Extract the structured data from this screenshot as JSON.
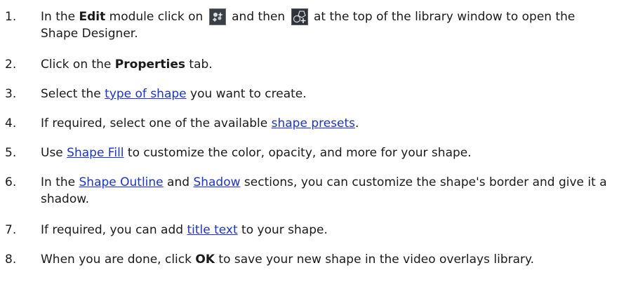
{
  "steps": [
    {
      "num": "1.",
      "parts": {
        "a": "In the ",
        "b": "Edit",
        "c": " module click on ",
        "icon1": "effects-toolbar-icon",
        "d": " and then ",
        "icon2": "add-shape-icon",
        "e": " at the top of the library window to open the Shape Designer."
      }
    },
    {
      "num": "2.",
      "parts": {
        "a": "Click on the ",
        "b": "Properties",
        "c": " tab."
      }
    },
    {
      "num": "3.",
      "parts": {
        "a": "Select the ",
        "link": "type of shape",
        "b": " you want to create."
      }
    },
    {
      "num": "4.",
      "parts": {
        "a": "If required, select one of the available ",
        "link": "shape presets",
        "b": "."
      }
    },
    {
      "num": "5.",
      "parts": {
        "a": "Use ",
        "link": "Shape Fill",
        "b": " to customize the color, opacity, and more for your shape."
      }
    },
    {
      "num": "6.",
      "parts": {
        "a": "In the ",
        "link1": "Shape Outline",
        "b": " and ",
        "link2": "Shadow",
        "c": " sections, you can customize the shape's border and give it a shadow."
      }
    },
    {
      "num": "7.",
      "parts": {
        "a": "If required, you can add ",
        "link": "title text",
        "b": " to your shape."
      }
    },
    {
      "num": "8.",
      "parts": {
        "a": "When you are done, click ",
        "b": "OK",
        "c": " to save your new shape in the video overlays library."
      }
    }
  ],
  "colors": {
    "link": "#1a33d6",
    "text": "#1a1a1a"
  }
}
